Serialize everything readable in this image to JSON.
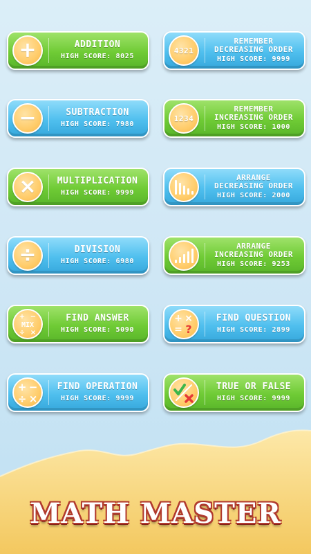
{
  "app": {
    "title": "MATH MASTER"
  },
  "games": {
    "addition": {
      "title": "ADDITION",
      "score": "HIGH SCORE: 8025",
      "icon": "plus-icon",
      "glyph": "+"
    },
    "remember_decreasing": {
      "title1": "REMEMBER",
      "title2": "DECREASING ORDER",
      "score": "HIGH SCORE: 9999",
      "icon": "number-sequence-icon",
      "badge_text": "4321"
    },
    "subtraction": {
      "title": "SUBTRACTION",
      "score": "HIGH SCORE: 7980",
      "icon": "minus-icon",
      "glyph": "−"
    },
    "remember_increasing": {
      "title1": "REMEMBER",
      "title2": "INCREASING ORDER",
      "score": "HIGH SCORE: 1000",
      "icon": "number-sequence-icon",
      "badge_text": "1234"
    },
    "multiplication": {
      "title": "MULTIPLICATION",
      "score": "HIGH SCORE: 9999",
      "icon": "times-icon",
      "glyph": "×"
    },
    "arrange_decreasing": {
      "title1": "ARRANGE",
      "title2": "DECREASING ORDER",
      "score": "HIGH SCORE: 2000",
      "icon": "bars-decreasing-icon"
    },
    "division": {
      "title": "DIVISION",
      "score": "HIGH SCORE: 6980",
      "icon": "divide-icon",
      "glyph": "÷"
    },
    "arrange_increasing": {
      "title1": "ARRANGE",
      "title2": "INCREASING ORDER",
      "score": "HIGH SCORE: 9253",
      "icon": "bars-increasing-icon"
    },
    "find_answer": {
      "title": "FIND ANSWER",
      "score": "HIGH SCORE: 5090",
      "icon": "mix-operators-icon",
      "badge_text": "MIX"
    },
    "find_question": {
      "title": "FIND QUESTION",
      "score": "HIGH SCORE: 2899",
      "icon": "question-operators-icon"
    },
    "find_operation": {
      "title": "FIND OPERATION",
      "score": "HIGH SCORE: 9999",
      "icon": "operators-grid-icon"
    },
    "true_or_false": {
      "title": "TRUE OR FALSE",
      "score": "HIGH SCORE: 9999",
      "icon": "check-cross-icon"
    }
  },
  "colors": {
    "green_card": "#6fcb35",
    "blue_card": "#4fbfee",
    "badge": "#ffcc6a",
    "sand": "#f6cf72",
    "title_outline": "#b13a2e",
    "check": "#3db64a",
    "cross": "#e53935"
  }
}
